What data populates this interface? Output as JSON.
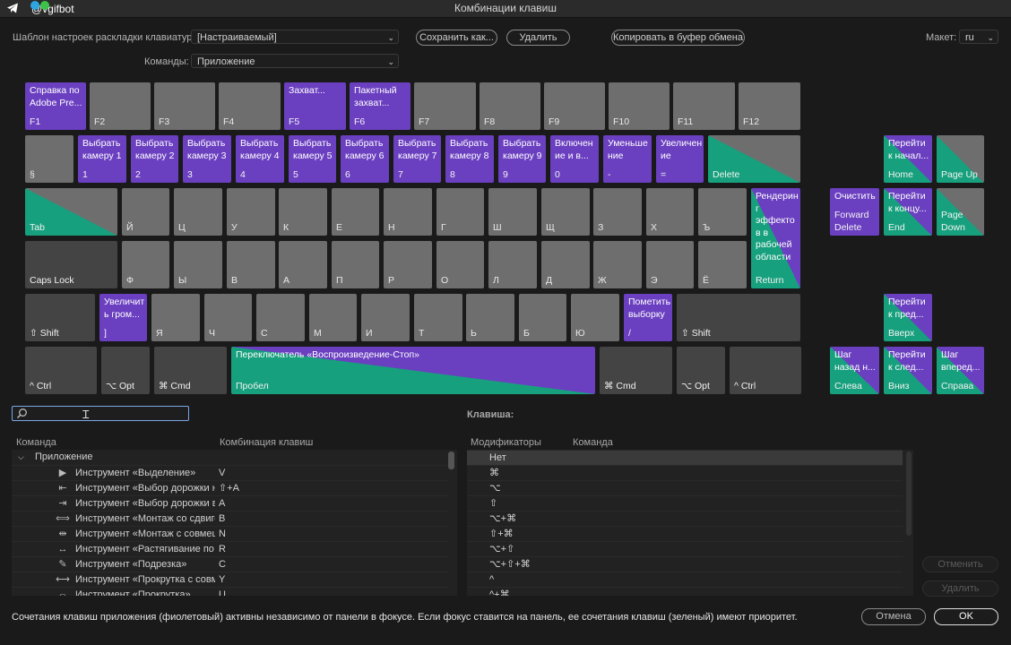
{
  "window_title": "Комбинации клавиш",
  "watermark": "@vgifbot",
  "top": {
    "preset_label": "Шаблон настроек раскладки клавиатуры:",
    "preset_value": "[Настраиваемый]",
    "save_as": "Сохранить как...",
    "delete": "Удалить",
    "copy_clipboard": "Копировать в буфер обмена",
    "layout_label": "Макет:",
    "layout_value": "ru",
    "commands_label": "Команды:",
    "commands_value": "Приложение"
  },
  "keys": {
    "f1": {
      "t": "Справка по\nAdobe Pre...",
      "k": "F1"
    },
    "f2": {
      "t": "",
      "k": "F2"
    },
    "f3": {
      "t": "",
      "k": "F3"
    },
    "f4": {
      "t": "",
      "k": "F4"
    },
    "f5": {
      "t": "Захват...",
      "k": "F5"
    },
    "f6": {
      "t": "Пакетный\nзахват...",
      "k": "F6"
    },
    "f7": {
      "t": "",
      "k": "F7"
    },
    "f8": {
      "t": "",
      "k": "F8"
    },
    "f9": {
      "t": "",
      "k": "F9"
    },
    "f10": {
      "t": "",
      "k": "F10"
    },
    "f11": {
      "t": "",
      "k": "F11"
    },
    "f12": {
      "t": "",
      "k": "F12"
    },
    "sect": {
      "t": "",
      "k": "§"
    },
    "n1": {
      "t": "Выбрать\nкамеру 1",
      "k": "1"
    },
    "n2": {
      "t": "Выбрать\nкамеру 2",
      "k": "2"
    },
    "n3": {
      "t": "Выбрать\nкамеру 3",
      "k": "3"
    },
    "n4": {
      "t": "Выбрать\nкамеру 4",
      "k": "4"
    },
    "n5": {
      "t": "Выбрать\nкамеру 5",
      "k": "5"
    },
    "n6": {
      "t": "Выбрать\nкамеру 6",
      "k": "6"
    },
    "n7": {
      "t": "Выбрать\nкамеру 7",
      "k": "7"
    },
    "n8": {
      "t": "Выбрать\nкамеру 8",
      "k": "8"
    },
    "n9": {
      "t": "Выбрать\nкамеру 9",
      "k": "9"
    },
    "n0": {
      "t": "Включен\nие и в...",
      "k": "0"
    },
    "minus": {
      "t": "Уменьше\nние",
      "k": "-"
    },
    "eq": {
      "t": "Увеличен\nие",
      "k": "="
    },
    "del": {
      "t": "",
      "k": "Delete"
    },
    "home": {
      "t": "Перейти\nк начал...",
      "k": "Home"
    },
    "pgup": {
      "t": "",
      "k": "Page Up"
    },
    "tab": {
      "t": "",
      "k": "Tab"
    },
    "q1": {
      "t": "",
      "k": "Й"
    },
    "q2": {
      "t": "",
      "k": "Ц"
    },
    "q3": {
      "t": "",
      "k": "У"
    },
    "q4": {
      "t": "",
      "k": "К"
    },
    "q5": {
      "t": "",
      "k": "Е"
    },
    "q6": {
      "t": "",
      "k": "Н"
    },
    "q7": {
      "t": "",
      "k": "Г"
    },
    "q8": {
      "t": "",
      "k": "Ш"
    },
    "q9": {
      "t": "",
      "k": "Щ"
    },
    "q10": {
      "t": "",
      "k": "З"
    },
    "q11": {
      "t": "",
      "k": "Х"
    },
    "q12": {
      "t": "",
      "k": "Ъ"
    },
    "ret": {
      "t": "Рендерин\nг\nэффекто\nв в\nрабочей\nобласти",
      "k": "Return"
    },
    "fdel": {
      "t": "Очистить",
      "k": "Forward\nDelete"
    },
    "end": {
      "t": "Перейти\nк концу...",
      "k": "End"
    },
    "pgdn": {
      "t": "",
      "k": "Page\nDown"
    },
    "caps": {
      "t": "",
      "k": "Caps Lock"
    },
    "a1": {
      "t": "",
      "k": "Ф"
    },
    "a2": {
      "t": "",
      "k": "Ы"
    },
    "a3": {
      "t": "",
      "k": "В"
    },
    "a4": {
      "t": "",
      "k": "А"
    },
    "a5": {
      "t": "",
      "k": "П"
    },
    "a6": {
      "t": "",
      "k": "Р"
    },
    "a7": {
      "t": "",
      "k": "О"
    },
    "a8": {
      "t": "",
      "k": "Л"
    },
    "a9": {
      "t": "",
      "k": "Д"
    },
    "a10": {
      "t": "",
      "k": "Ж"
    },
    "a11": {
      "t": "",
      "k": "Э"
    },
    "a12": {
      "t": "",
      "k": "Ё"
    },
    "lshift": {
      "t": "",
      "k": "⇧ Shift"
    },
    "z0": {
      "t": "Увеличит\nь гром...",
      "k": "]"
    },
    "z1": {
      "t": "",
      "k": "Я"
    },
    "z2": {
      "t": "",
      "k": "Ч"
    },
    "z3": {
      "t": "",
      "k": "С"
    },
    "z4": {
      "t": "",
      "k": "М"
    },
    "z5": {
      "t": "",
      "k": "И"
    },
    "z6": {
      "t": "",
      "k": "Т"
    },
    "z7": {
      "t": "",
      "k": "Ь"
    },
    "z8": {
      "t": "",
      "k": "Б"
    },
    "z9": {
      "t": "",
      "k": "Ю"
    },
    "slash": {
      "t": "Пометить\nвыборку",
      "k": "/"
    },
    "rshift": {
      "t": "",
      "k": "⇧ Shift"
    },
    "up": {
      "t": "Перейти\nк пред...",
      "k": "Вверх"
    },
    "lctrl": {
      "t": "",
      "k": "^ Ctrl"
    },
    "lopt": {
      "t": "",
      "k": "⌥ Opt"
    },
    "lcmd": {
      "t": "",
      "k": "⌘ Cmd"
    },
    "space": {
      "t": "Переключатель «Воспроизведение-Стоп»",
      "k": "Пробел"
    },
    "rcmd": {
      "t": "",
      "k": "⌘ Cmd"
    },
    "ropt": {
      "t": "",
      "k": "⌥ Opt"
    },
    "rctrl": {
      "t": "",
      "k": "^ Ctrl"
    },
    "left": {
      "t": "Шаг\nназад н...",
      "k": "Слева"
    },
    "down": {
      "t": "Перейти\nк след...",
      "k": "Вниз"
    },
    "right": {
      "t": "Шаг\nвперед...",
      "k": "Справа"
    }
  },
  "lower": {
    "key_label": "Клавиша:",
    "col_command": "Команда",
    "col_shortcut": "Комбинация клавиш",
    "col_modifiers": "Модификаторы",
    "col_command2": "Команда",
    "group": "Приложение",
    "rows": [
      {
        "icon": "▶",
        "name": "Инструмент «Выделение»",
        "sc": "V"
      },
      {
        "icon": "⇤",
        "name": "Инструмент «Выбор дорожки наз",
        "sc": "⇧+A"
      },
      {
        "icon": "⇥",
        "name": "Инструмент «Выбор дорожки впе",
        "sc": "A"
      },
      {
        "icon": "⟺",
        "name": "Инструмент «Монтаж со сдвигом",
        "sc": "B"
      },
      {
        "icon": "⇹",
        "name": "Инструмент «Монтаж с совмеще",
        "sc": "N"
      },
      {
        "icon": "↔",
        "name": "Инструмент «Растягивание по ск",
        "sc": "R"
      },
      {
        "icon": "✎",
        "name": "Инструмент «Подрезка»",
        "sc": "C"
      },
      {
        "icon": "⟷",
        "name": "Инструмент «Прокрутка с совме",
        "sc": "Y"
      },
      {
        "icon": "⇔",
        "name": "Инструмент «Прокрутка»",
        "sc": "U"
      }
    ],
    "modifiers": [
      "Нет",
      "⌘",
      "⌥",
      "⇧",
      "⌥+⌘",
      "⇧+⌘",
      "⌥+⇧",
      "⌥+⇧+⌘",
      "^",
      "^+⌘"
    ],
    "undo": "Отменить",
    "remove": "Удалить"
  },
  "footer": {
    "note": "Сочетания клавиш приложения (фиолетовый) активны независимо от панели в фокусе. Если фокус ставится на панель, ее сочетания клавиш (зеленый) имеют приоритет.",
    "cancel": "Отмена",
    "ok": "OK"
  },
  "colors": {
    "app": "#6a3fc0",
    "panel": "#17a07d",
    "unassigned": "#6e6e6e"
  }
}
